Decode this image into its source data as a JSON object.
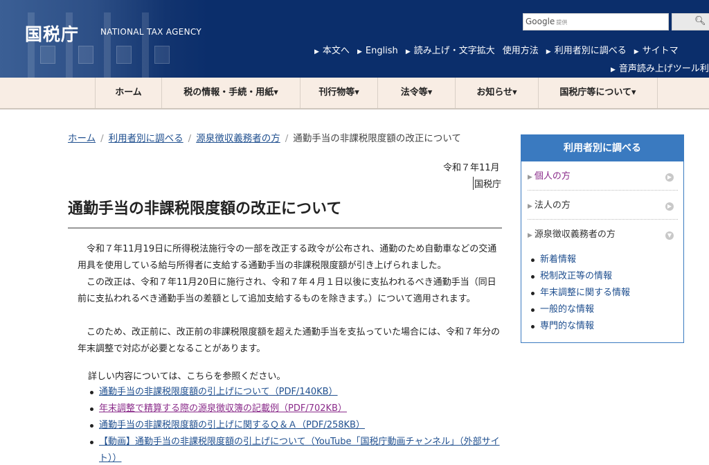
{
  "header": {
    "logo_title": "国税庁",
    "logo_subtitle": "NATIONAL TAX AGENCY",
    "search": {
      "brand": "Google",
      "brand_suffix": "提供",
      "button_icon": "search-icon"
    },
    "links": [
      "本文へ",
      "English",
      "読み上げ・文字拡大",
      "使用方法",
      "利用者別に調べる",
      "サイトマ"
    ],
    "links_row2": [
      "音声読み上げツール利"
    ]
  },
  "gnav": {
    "items": [
      "ホーム",
      "税の情報・手続・用紙▾",
      "刊行物等▾",
      "法令等▾",
      "お知らせ▾",
      "国税庁等について▾"
    ]
  },
  "breadcrumb": {
    "items": [
      "ホーム",
      "利用者別に調べる",
      "源泉徴収義務者の方"
    ],
    "current": "通勤手当の非課税限度額の改正について"
  },
  "article": {
    "date": "令和７年11月",
    "author": "国税庁",
    "title": "通勤手当の非課税限度額の改正について",
    "p1": "令和７年11月19日に所得税法施行令の一部を改正する政令が公布され、通勤のため自動車などの交通用具を使用している給与所得者に支給する通勤手当の非課税限度額が引き上げられました。",
    "p2": "この改正は、令和７年11月20日に施行され、令和７年４月１日以後に支払われるべき通勤手当（同日前に支払われるべき通勤手当の差額として追加支給するものを除きます。）について適用されます。",
    "p3": "このため、改正前に、改正前の非課税限度額を超えた通勤手当を支払っていた場合には、令和７年分の年末調整で対応が必要となることがあります。",
    "detail_intro": "詳しい内容については、こちらを参照ください。",
    "links": [
      "通勤手当の非課税限度額の引上げについて（PDF/140KB）",
      "年末調整で精算する際の源泉徴収簿の記載例（PDF/702KB）",
      "通勤手当の非課税限度額の引上げに関するＱ＆Ａ（PDF/258KB）",
      "【動画】通勤手当の非課税限度額の引上げについて（YouTube「国税庁動画チャンネル」（外部サイト））"
    ]
  },
  "sidebar": {
    "title": "利用者別に調べる",
    "items": [
      "個人の方",
      "法人の方",
      "源泉徴収義務者の方"
    ],
    "sub_items": [
      "新着情報",
      "税制改正等の情報",
      "年末調整に関する情報",
      "一般的な情報",
      "専門的な情報"
    ]
  }
}
